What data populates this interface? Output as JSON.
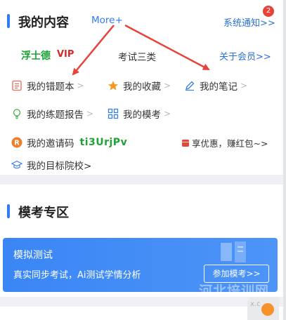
{
  "my_content": {
    "title": "我的内容",
    "more_label": "More+",
    "notice_label": "系统通知>>",
    "notice_badge": "2",
    "member_name": "浮士德",
    "vip_label": "VIP",
    "exam_category": "考试三类",
    "about_member": "关于会员>>",
    "items": {
      "wrong_book": "我的错题本",
      "favorites": "我的收藏",
      "notes": "我的笔记",
      "practice_report": "我的练题报告",
      "mock_exams": "我的模考"
    },
    "invite_label": "我的邀请码",
    "invite_code": "ti3UrjPv",
    "promo_label": "享优惠，赚红包~>",
    "target_school": "我的目标院校>"
  },
  "mock_zone": {
    "title": "模考专区",
    "card_title": "模拟测试",
    "card_subtitle": "真实同步考试，Ai测试学情分析",
    "join_button": "参加模考>>"
  },
  "watermark": "河北培训网",
  "floating_text": "x.c",
  "colors": {
    "accent_blue": "#2f7cf6",
    "annotation_red": "#e8433a",
    "green": "#1fa336"
  }
}
